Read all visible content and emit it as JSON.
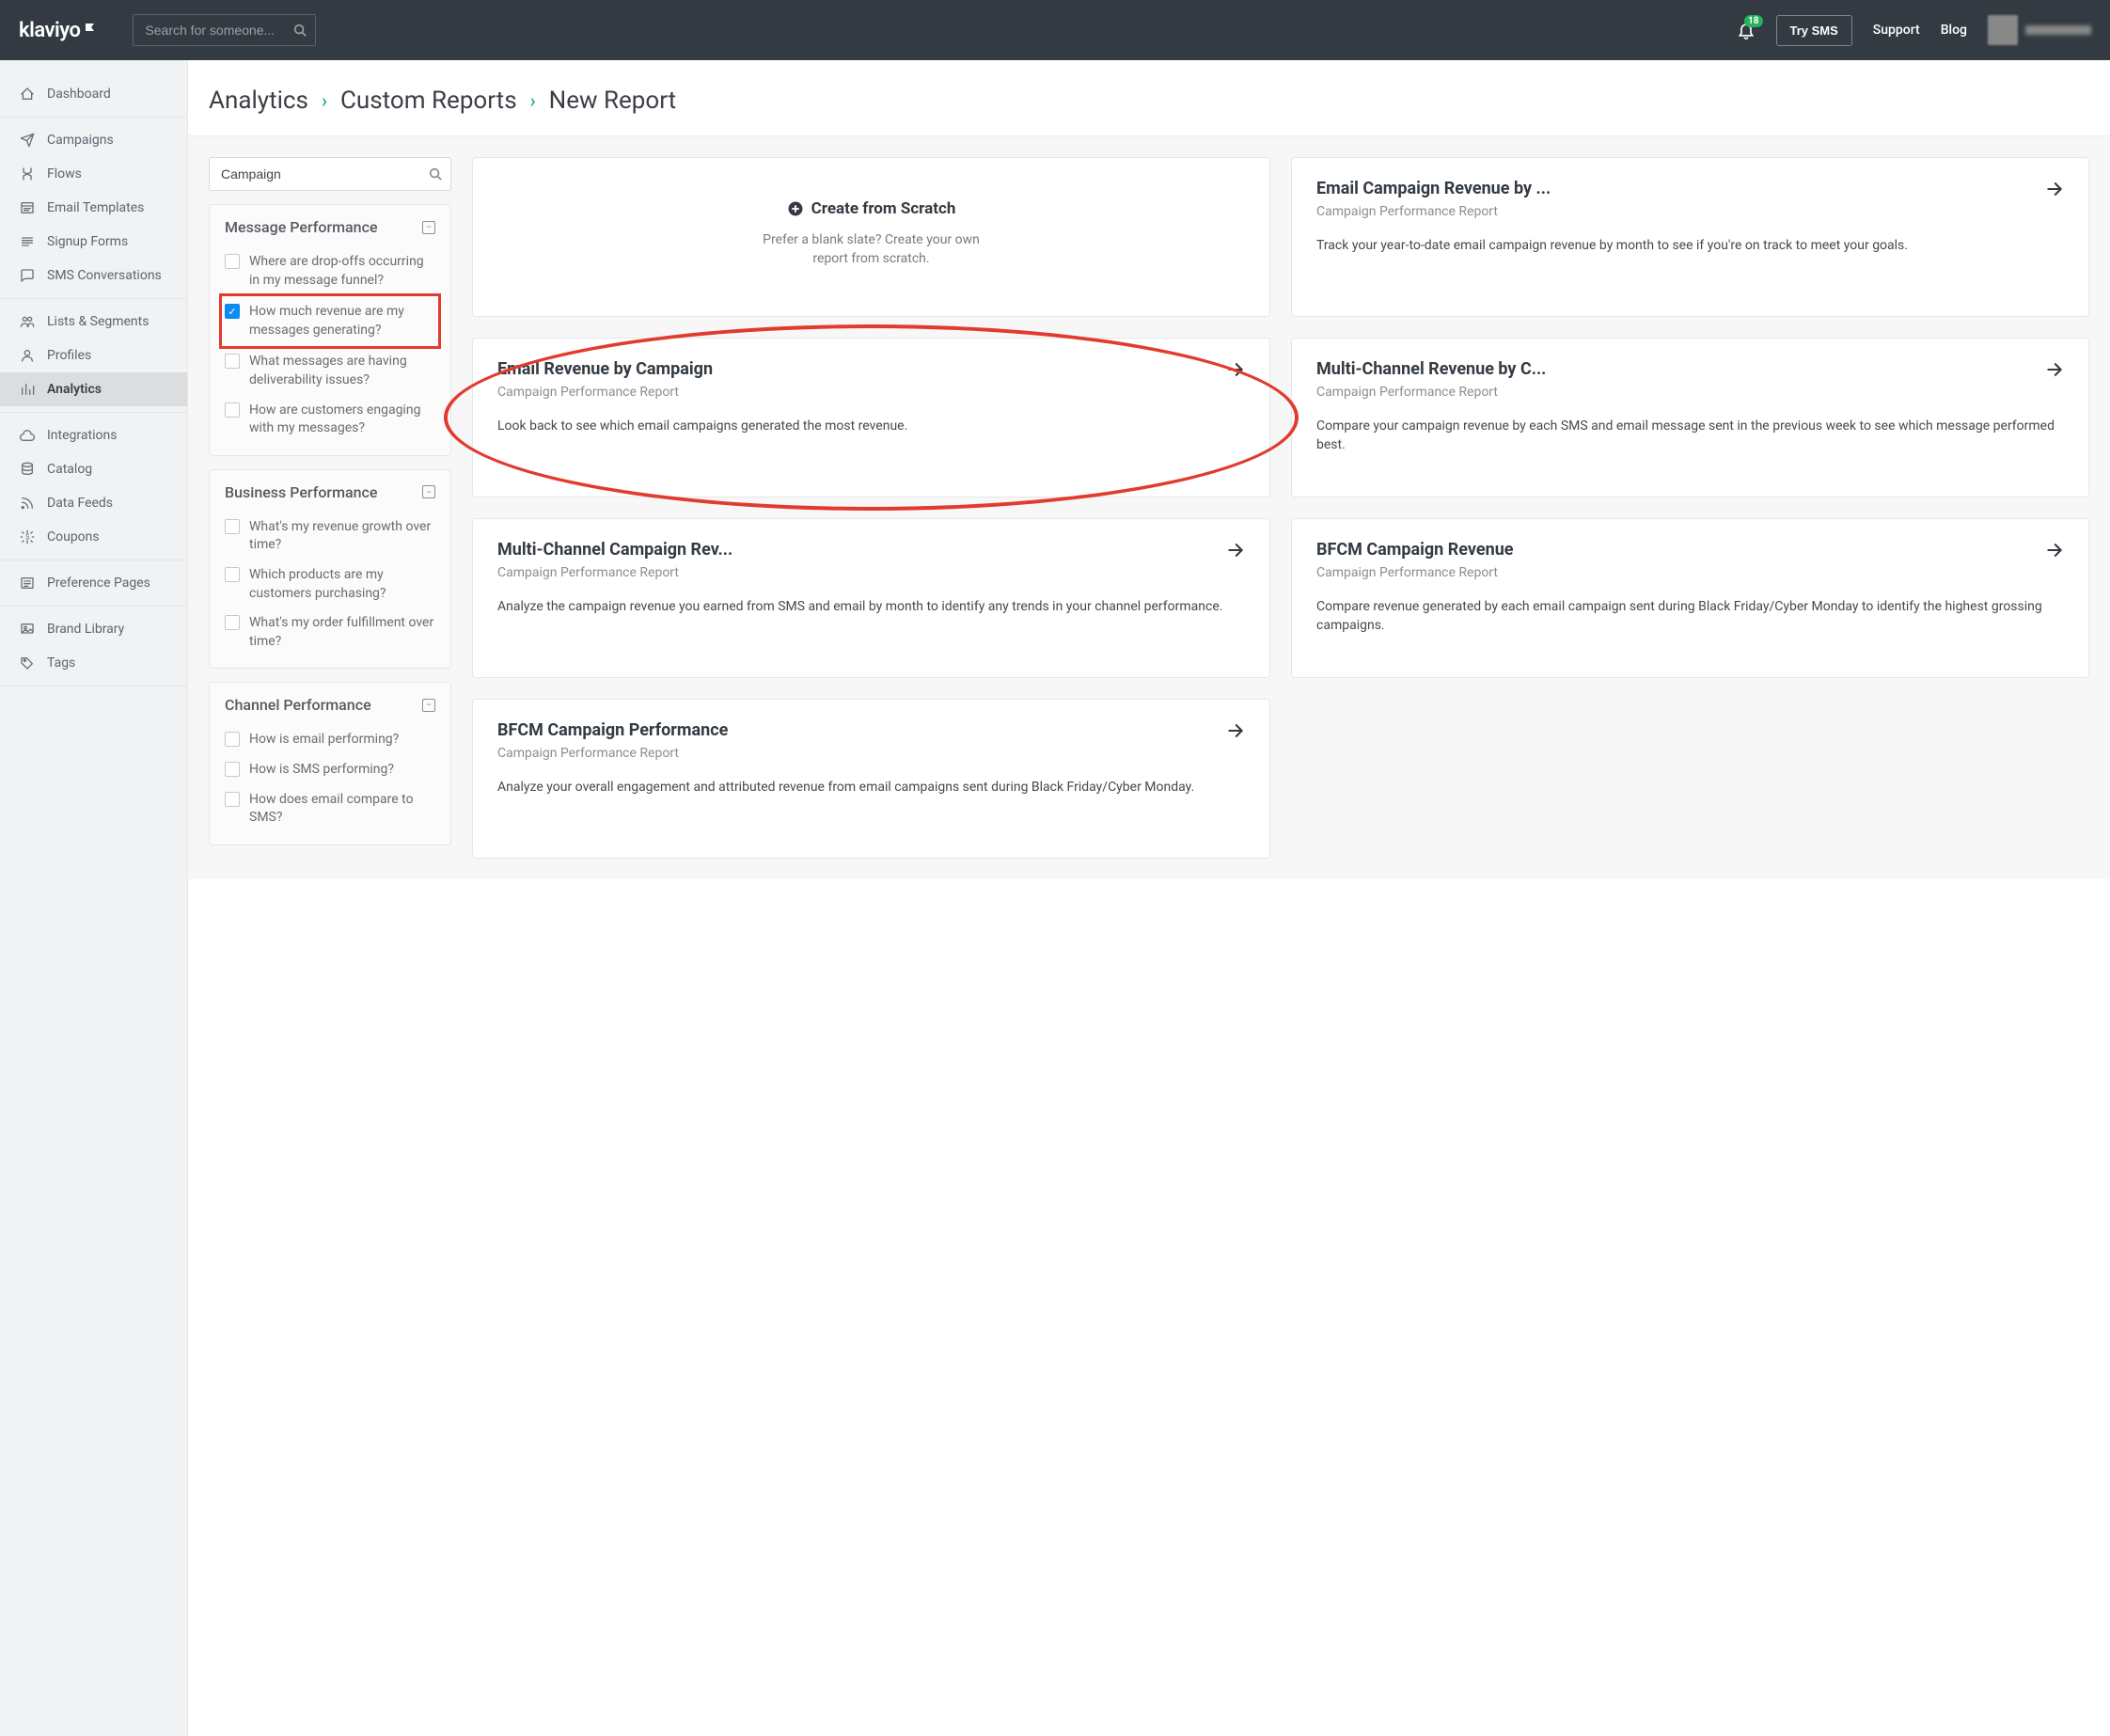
{
  "header": {
    "logo_text": "klaviyo",
    "search_placeholder": "Search for someone...",
    "notification_count": "18",
    "try_sms_label": "Try SMS",
    "support_label": "Support",
    "blog_label": "Blog"
  },
  "sidebar": {
    "groups": [
      {
        "items": [
          {
            "icon": "dashboard",
            "label": "Dashboard"
          }
        ]
      },
      {
        "items": [
          {
            "icon": "campaigns",
            "label": "Campaigns"
          },
          {
            "icon": "flows",
            "label": "Flows"
          },
          {
            "icon": "templates",
            "label": "Email Templates"
          },
          {
            "icon": "forms",
            "label": "Signup Forms"
          },
          {
            "icon": "sms",
            "label": "SMS Conversations"
          }
        ]
      },
      {
        "items": [
          {
            "icon": "lists",
            "label": "Lists & Segments"
          },
          {
            "icon": "profiles",
            "label": "Profiles"
          },
          {
            "icon": "analytics",
            "label": "Analytics",
            "active": true
          }
        ]
      },
      {
        "items": [
          {
            "icon": "integrations",
            "label": "Integrations"
          },
          {
            "icon": "catalog",
            "label": "Catalog"
          },
          {
            "icon": "feeds",
            "label": "Data Feeds"
          },
          {
            "icon": "coupons",
            "label": "Coupons"
          }
        ]
      },
      {
        "items": [
          {
            "icon": "preference",
            "label": "Preference Pages"
          }
        ]
      },
      {
        "items": [
          {
            "icon": "brand",
            "label": "Brand Library"
          },
          {
            "icon": "tags",
            "label": "Tags"
          }
        ]
      }
    ]
  },
  "breadcrumb": {
    "items": [
      "Analytics",
      "Custom Reports",
      "New Report"
    ]
  },
  "filter": {
    "search_value": "Campaign",
    "panels": [
      {
        "title": "Message Performance",
        "items": [
          {
            "label": "Where are drop-offs occurring in my message funnel?",
            "checked": false
          },
          {
            "label": "How much revenue are my messages generating?",
            "checked": true,
            "highlighted": true
          },
          {
            "label": "What messages are having deliverability issues?",
            "checked": false
          },
          {
            "label": "How are customers engaging with my messages?",
            "checked": false
          }
        ]
      },
      {
        "title": "Business Performance",
        "items": [
          {
            "label": "What's my revenue growth over time?",
            "checked": false
          },
          {
            "label": "Which products are my customers purchasing?",
            "checked": false
          },
          {
            "label": "What's my order fulfillment over time?",
            "checked": false
          }
        ]
      },
      {
        "title": "Channel Performance",
        "items": [
          {
            "label": "How is email performing?",
            "checked": false
          },
          {
            "label": "How is SMS performing?",
            "checked": false
          },
          {
            "label": "How does email compare to SMS?",
            "checked": false
          }
        ]
      }
    ]
  },
  "cards": {
    "scratch": {
      "title": "Create from Scratch",
      "desc": "Prefer a blank slate? Create your own report from scratch."
    },
    "list": [
      {
        "title": "Email Campaign Revenue by ...",
        "sub": "Campaign Performance Report",
        "desc": "Track your year-to-date email campaign revenue by month to see if you're on track to meet your goals."
      },
      {
        "title": "Email Revenue by Campaign",
        "sub": "Campaign Performance Report",
        "desc": "Look back to see which email campaigns generated the most revenue.",
        "circled": true
      },
      {
        "title": "Multi-Channel Revenue by C...",
        "sub": "Campaign Performance Report",
        "desc": "Compare your campaign revenue by each SMS and email message sent in the previous week to see which message performed best."
      },
      {
        "title": "Multi-Channel Campaign Rev...",
        "sub": "Campaign Performance Report",
        "desc": "Analyze the campaign revenue you earned from SMS and email by month to identify any trends in your channel performance."
      },
      {
        "title": "BFCM Campaign Revenue",
        "sub": "Campaign Performance Report",
        "desc": "Compare revenue generated by each email campaign sent during Black Friday/Cyber Monday to identify the highest grossing campaigns."
      },
      {
        "title": "BFCM Campaign Performance",
        "sub": "Campaign Performance Report",
        "desc": "Analyze your overall engagement and attributed revenue from email campaigns sent during Black Friday/Cyber Monday."
      }
    ]
  }
}
